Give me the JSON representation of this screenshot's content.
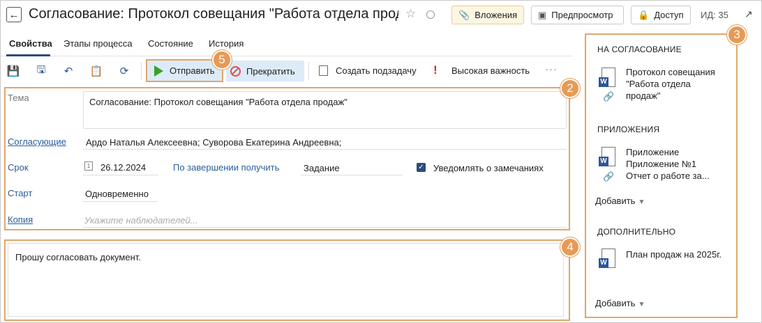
{
  "header": {
    "title": "Согласование: Протокол совещания \"Работа отдела прод...",
    "attachments_label": "Вложения",
    "preview_label": "Предпросмотр",
    "access_label": "Доступ",
    "id_label": "ИД: 35"
  },
  "tabs": [
    {
      "label": "Свойства",
      "active": true
    },
    {
      "label": "Этапы процесса",
      "active": false
    },
    {
      "label": "Состояние",
      "active": false
    },
    {
      "label": "История",
      "active": false
    }
  ],
  "toolbar": {
    "send_label": "Отправить",
    "stop_label": "Прекратить",
    "subtask_label": "Создать подзадачу",
    "importance_label": "Высокая важность",
    "more_label": "···"
  },
  "callouts": [
    "2",
    "3",
    "4",
    "5"
  ],
  "fields": {
    "subject_label": "Тема",
    "subject_value": "Согласование: Протокол совещания \"Работа отдела продаж\"",
    "approvers_label": "Согласующие",
    "approvers_value": "Ардо Наталья Алексеевна; Суворова Екатерина Андреевна;",
    "deadline_label": "Срок",
    "deadline_calendar_day": "1",
    "deadline_value": "26.12.2024",
    "on_complete_label": "По завершении получить",
    "on_complete_value": "Задание",
    "notify_label": "Уведомлять о замечаниях",
    "notify_checked": true,
    "start_label": "Старт",
    "start_value": "Одновременно",
    "copy_label": "Копия",
    "copy_placeholder": "Укажите наблюдателей..."
  },
  "comment": "Прошу согласовать документ.",
  "right_panel": {
    "for_approval_title": "НА СОГЛАСОВАНИЕ",
    "for_approval_doc": [
      "Протокол совещания",
      "\"Работа отдела",
      "продаж\""
    ],
    "attachments_title": "ПРИЛОЖЕНИЯ",
    "attachments_docs": [
      "Приложение",
      "Приложение №1",
      "Отчет о работе за..."
    ],
    "add_label": "Добавить",
    "extra_title": "ДОПОЛНИТЕЛЬНО",
    "extra_doc": "План продаж на 2025г.",
    "word_badge": "W"
  },
  "colors": {
    "accent": "#e69a55",
    "primary": "#2a4d7a",
    "link": "#2a5d9a",
    "send_green": "#3aa02a",
    "stop_red": "#d9534f"
  }
}
